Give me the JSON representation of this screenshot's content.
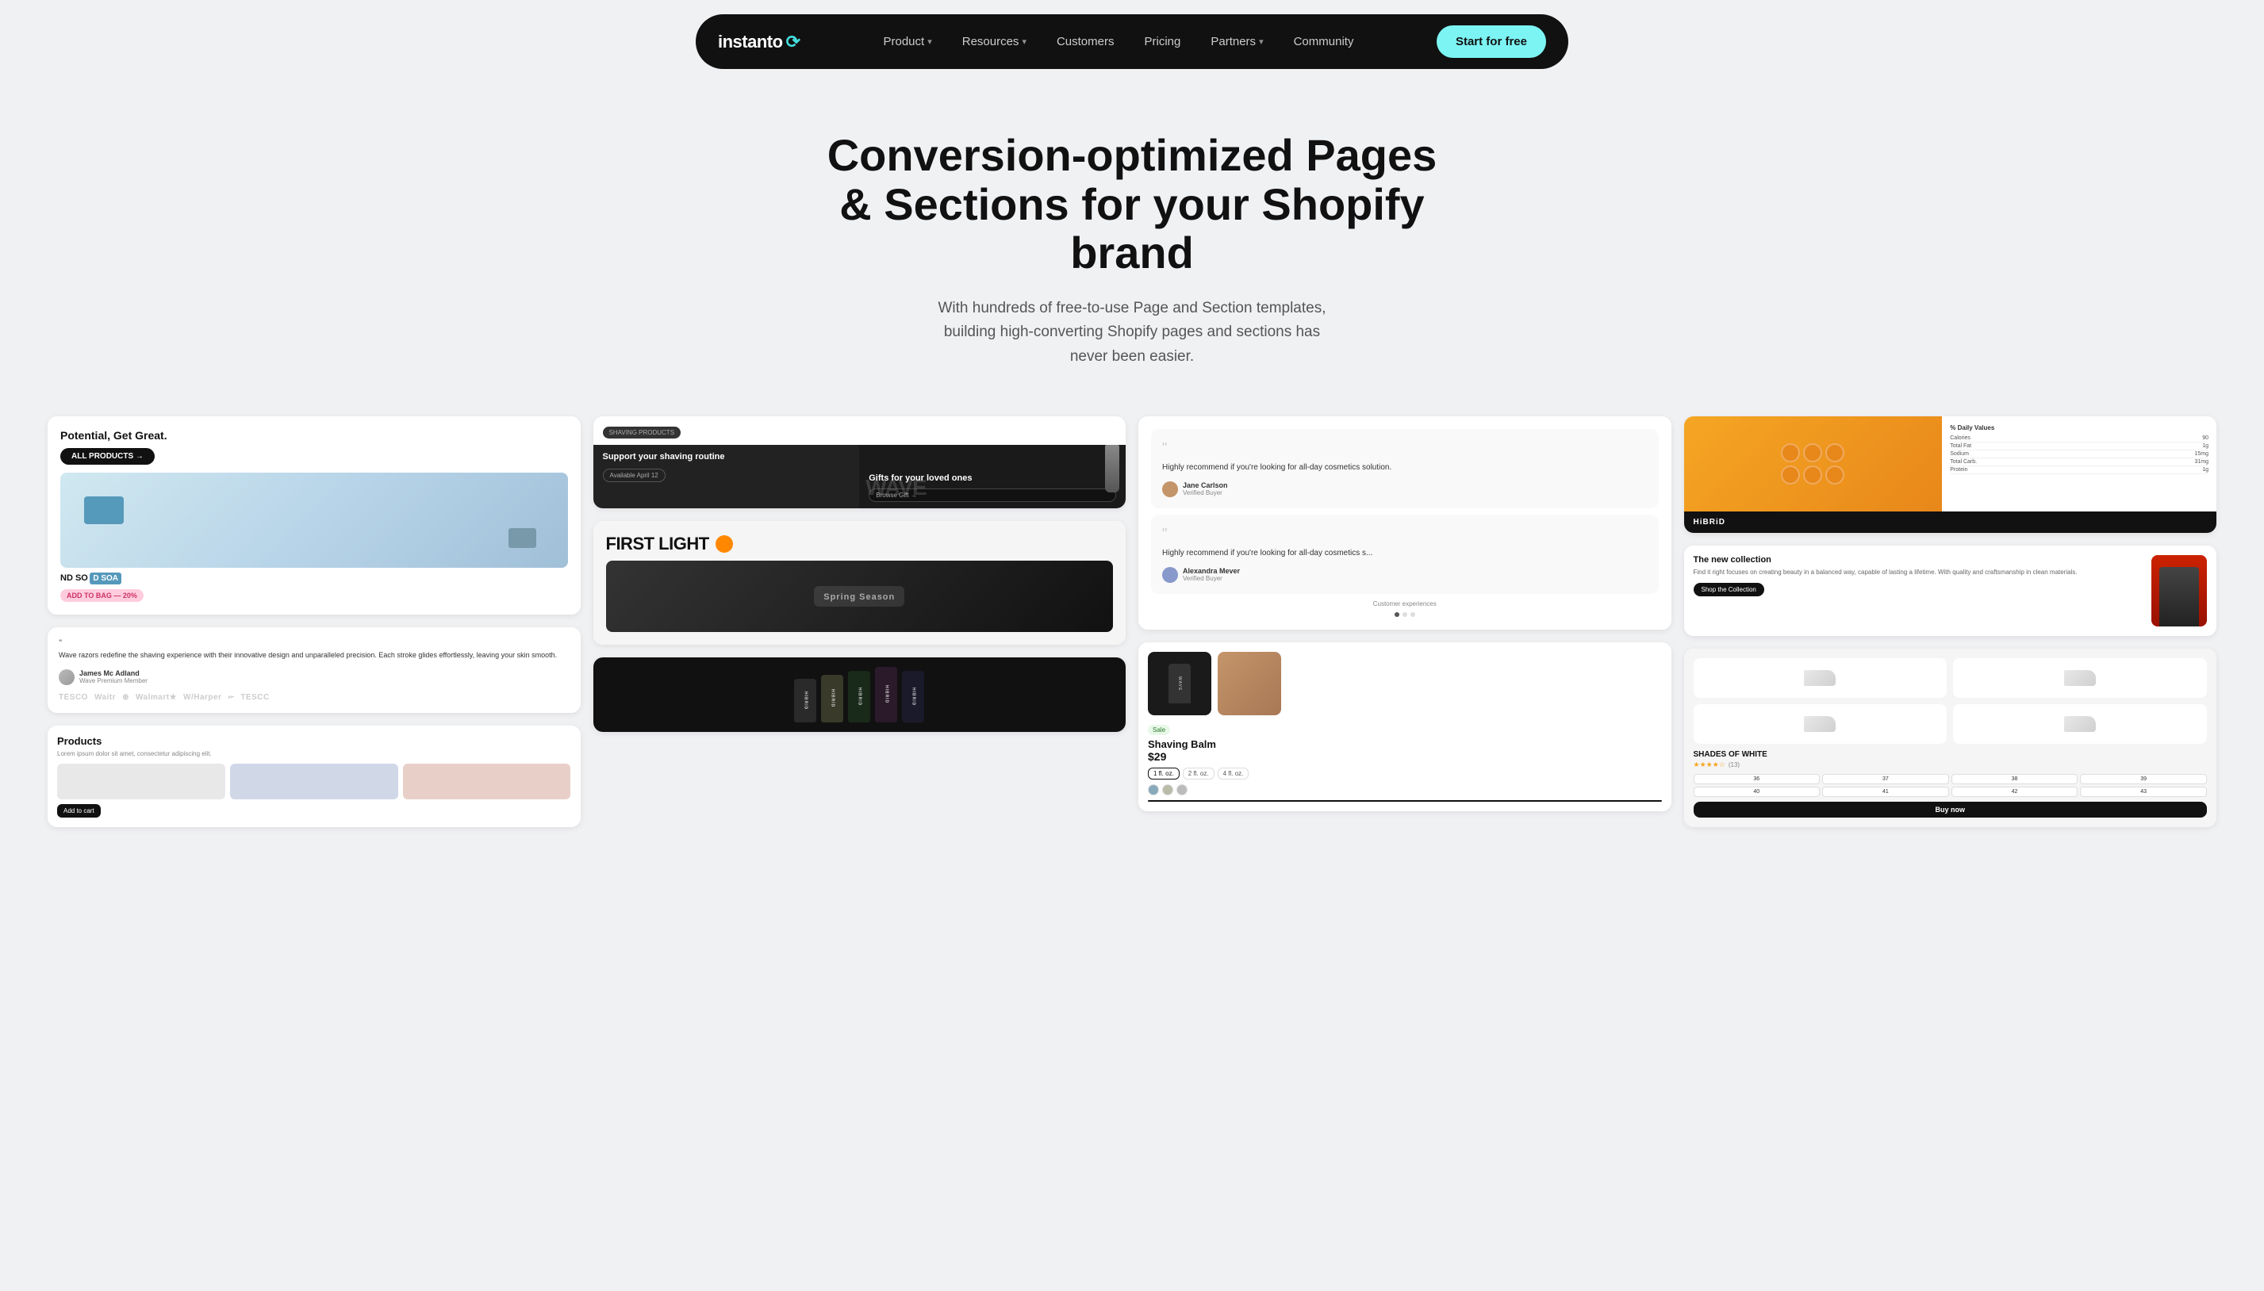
{
  "nav": {
    "logo_text": "instanto",
    "links": [
      {
        "label": "Product",
        "has_dropdown": true
      },
      {
        "label": "Resources",
        "has_dropdown": true
      },
      {
        "label": "Customers",
        "has_dropdown": false
      },
      {
        "label": "Pricing",
        "has_dropdown": false
      },
      {
        "label": "Partners",
        "has_dropdown": true
      },
      {
        "label": "Community",
        "has_dropdown": false
      }
    ],
    "cta_label": "Start for free"
  },
  "hero": {
    "title": "Conversion-optimized Pages & Sections for your Shopify brand",
    "subtitle": "With hundreds of free-to-use Page and Section templates, building high-converting Shopify pages and sections has never been easier."
  },
  "templates": {
    "col1": {
      "card_title": "Potential, Get Great.",
      "btn_label": "ALL PRODUCTS →",
      "testimonial_text": "Wave razors redefine the shaving experience with their innovative design and unparalleled precision. Each stroke glides effortlessly, leaving your skin smooth.",
      "testimonial_author": "James Mc Adland",
      "testimonial_role": "Wave Premium Member",
      "logos": [
        "TESCO",
        "Waitr",
        "⊕",
        "Walmart",
        "W/Harper",
        "🖙",
        "TESC"
      ],
      "products_title": "Products",
      "products_sub": "Lorem ipsum dolor sit amet, consectetur adipiscing elit."
    },
    "col2": {
      "shaving_tag": "SHAVING PRODUCTS",
      "shaving_left": "Support your shaving routine",
      "shaving_right": "Gifts for your loved ones",
      "wave_text": "WAVE",
      "first_light": "FIRST LIGHT",
      "spring_season": "Spring Season"
    },
    "col3": {
      "testimonial1": "Highly recommend if you're looking for all-day cosmetics solution.",
      "testimonial2": "Highly recommend if you're looking for all-day cosmetics s...",
      "author1_name": "Jane Carlson",
      "author1_role": "Verified Buyer",
      "author2_name": "Alexandra Mever",
      "author2_role": "Verified Buyer",
      "custom_exp": "Customer experiences",
      "shaving_balm": "Shaving Balm",
      "shaving_price": "$29",
      "shaving_badge": "Sale"
    },
    "col4": {
      "nutrition_title": "% Daily Values",
      "nutrients": [
        "Calories",
        "Total Fat",
        "Sodium",
        "Total Carb.",
        "Protein"
      ],
      "nutrient_vals": [
        "90",
        "1g",
        "15mg",
        "31mg",
        "1g"
      ],
      "new_collection": "The new collection",
      "new_collection_text": "Find it right focuses on creating beauty in a balanced way, capable of lasting a lifetime. With quality and craftsmanship in clean materials.",
      "shop_btn": "Shop the Collection",
      "shades_title": "SHADES OF WHITE",
      "stars": "★★★★☆",
      "rating": "(13)",
      "sizes": [
        "36",
        "37",
        "38",
        "39",
        "40",
        "41",
        "42",
        "43"
      ],
      "buy_btn": "Buy now"
    }
  }
}
